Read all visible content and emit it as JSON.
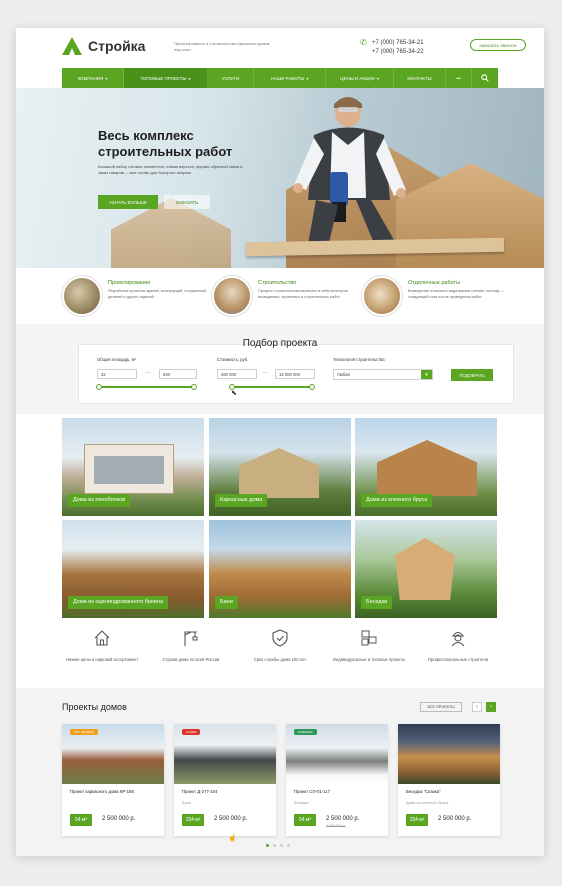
{
  "header": {
    "brand": "Стройка",
    "tagline": "Проектирование и строительство каркасных домов под ключ",
    "phone_primary": "+7 (000) 765-34-21",
    "phone_secondary": "+7 (000) 765-34-22",
    "callback_label": "Заказать звонок"
  },
  "nav": {
    "items": [
      {
        "label": "Компания",
        "dropdown": true
      },
      {
        "label": "Типовые проекты",
        "dropdown": true,
        "active": true
      },
      {
        "label": "Услуги",
        "dropdown": false
      },
      {
        "label": "Наши работы",
        "dropdown": true
      },
      {
        "label": "Цены и акции",
        "dropdown": true
      },
      {
        "label": "Контакты",
        "dropdown": false
      },
      {
        "label": "•••",
        "dropdown": false
      }
    ],
    "search_icon": "search-icon",
    "caret": "▾"
  },
  "hero": {
    "title": "Весь комплекс строительных работ",
    "text": "Большой набор готовых элементов, гибкая верстка, формы обратной связи и заказ товаров — все готово для быстрого запуска",
    "primary_label": "Узнать больше",
    "secondary_label": "Заказать"
  },
  "services": [
    {
      "title": "Проектирование",
      "text": "Разработка проектов зданий, конструкций, сооружений, деталей и других изделий"
    },
    {
      "title": "Строительство",
      "text": "Процесс строительства включает в себя категории возводимых, проектных и строительных работ"
    },
    {
      "title": "Отделочные работы",
      "text": "Возведение отличного вида вашим стенам, потолку — следующий этап после проведения работ"
    }
  ],
  "filter": {
    "title": "Подбор проекта",
    "area_label": "Общая площадь, м²",
    "area_from": "32",
    "area_to": "540",
    "cost_label": "Стоимость, руб.",
    "cost_from": "460 000",
    "cost_to": "15 000 000",
    "tech_label": "Технология строительства",
    "tech_value": "Любая",
    "submit_label": "Подобрать",
    "dash": "—",
    "select_caret": "▾"
  },
  "categories": [
    {
      "label": "Дома из пеноблоков"
    },
    {
      "label": "Каркасные дома"
    },
    {
      "label": "Дома из клееного бруса"
    },
    {
      "label": "Дома из оцилиндрованного бревна"
    },
    {
      "label": "Бани"
    },
    {
      "label": "Беседки"
    }
  ],
  "features": [
    {
      "icon": "house-icon",
      "text": "Низкие цены и широкий ассортимент"
    },
    {
      "icon": "crane-icon",
      "text": "Строим дома по всей России"
    },
    {
      "icon": "shield-icon",
      "text": "Срок службы дома 100 лет"
    },
    {
      "icon": "blocks-icon",
      "text": "Индивидуальные и типовые проекты"
    },
    {
      "icon": "builder-icon",
      "text": "Профессиональные строители"
    }
  ],
  "projects": {
    "title": "Проекты домов",
    "all_label": "Все проекты",
    "prev": "‹",
    "next": "›",
    "items": [
      {
        "badge": "Хит продаж",
        "badge_color": "#f0a01c",
        "name": "Проект каркасного дома КР-156",
        "sub": "",
        "area": "54 м²",
        "price": "2 500 000 р.",
        "old_price": ""
      },
      {
        "badge": "Акция",
        "badge_color": "#d9352a",
        "name": "Проект Д-277-104",
        "sub": "Баня",
        "area": "154 м²",
        "price": "2 500 000 р.",
        "old_price": ""
      },
      {
        "badge": "Новинка",
        "badge_color": "#2c9a59",
        "name": "Проект СП-01-117",
        "sub": "Беседка",
        "area": "54 м²",
        "price": "2 500 000 р.",
        "old_price": "3 500 000 р."
      },
      {
        "badge": "",
        "badge_color": "",
        "name": "Беседка \"Сказка\"",
        "sub": "Дома из клееного бруса",
        "area": "154 м²",
        "price": "2 500 000 р.",
        "old_price": ""
      }
    ]
  },
  "colors": {
    "accent": "#5aa622",
    "accent_dark": "#4a9119"
  }
}
